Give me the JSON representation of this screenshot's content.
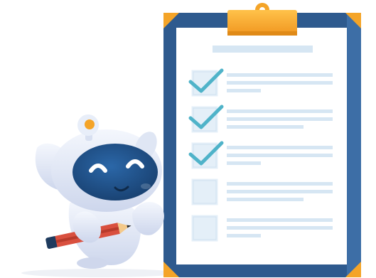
{
  "illustration": {
    "subject": "robot-with-pencil-and-checklist",
    "colors": {
      "board_navy": "#2e5a8e",
      "board_navy_light": "#3d6ea6",
      "paper": "#ffffff",
      "placeholder_line": "#d6e6f3",
      "checkbox_fill": "#e4eff8",
      "checkmark": "#4fb3c9",
      "clip_orange": "#f4a428",
      "robot_body": "#eef2fb",
      "robot_face": "#1f4e85",
      "pencil_red": "#d9503f"
    }
  },
  "checklist": {
    "items": [
      {
        "checked": true
      },
      {
        "checked": true
      },
      {
        "checked": true
      },
      {
        "checked": false
      },
      {
        "checked": false
      }
    ]
  }
}
